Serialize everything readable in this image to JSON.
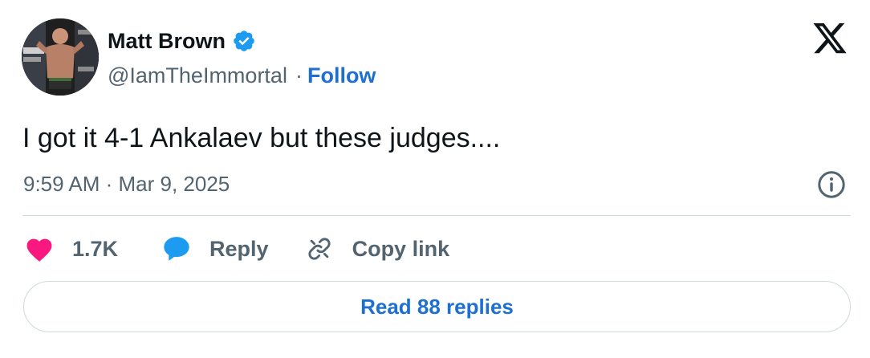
{
  "author": {
    "name": "Matt Brown",
    "handle": "@IamTheImmortal",
    "separator": "·",
    "follow_label": "Follow",
    "verified_icon": "verified-badge-icon"
  },
  "tweet": {
    "text": "I got it 4-1 Ankalaev but these judges....",
    "timestamp": "9:59 AM · Mar 9, 2025"
  },
  "actions": {
    "like_count": "1.7K",
    "reply_label": "Reply",
    "copy_link_label": "Copy link"
  },
  "read_replies_label": "Read 88 replies",
  "icons": {
    "logo": "x-logo-icon",
    "info": "info-icon",
    "like": "heart-icon",
    "reply": "speech-bubble-icon",
    "copy": "link-icon"
  },
  "colors": {
    "accent": "#1d6fd1",
    "verified": "#1d9bf0",
    "heart": "#f91880",
    "secondary_text": "#536471",
    "border": "#cfd9de"
  }
}
